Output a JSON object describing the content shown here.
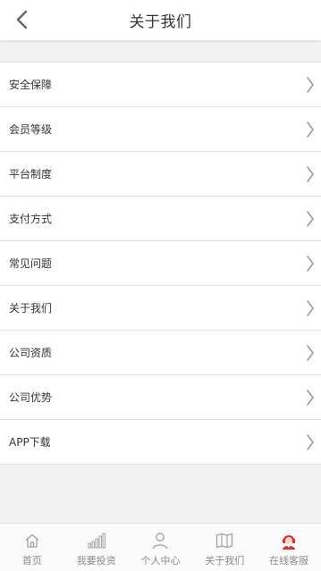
{
  "header": {
    "title": "关于我们"
  },
  "menu": {
    "items": [
      {
        "label": "安全保障"
      },
      {
        "label": "会员等级"
      },
      {
        "label": "平台制度"
      },
      {
        "label": "支付方式"
      },
      {
        "label": "常见问题"
      },
      {
        "label": "关于我们"
      },
      {
        "label": "公司资质"
      },
      {
        "label": "公司优势"
      },
      {
        "label": "APP下载"
      }
    ]
  },
  "tabbar": {
    "tabs": [
      {
        "label": "首页",
        "icon": "home-icon"
      },
      {
        "label": "我要投资",
        "icon": "bar-chart-icon"
      },
      {
        "label": "个人中心",
        "icon": "user-icon"
      },
      {
        "label": "关于我们",
        "icon": "map-book-icon"
      },
      {
        "label": "在线客服",
        "icon": "customer-service-icon"
      }
    ]
  },
  "colors": {
    "accent": "#e02a2a",
    "tab_icon": "#a0a0a0",
    "chevron": "#9a9a9a"
  }
}
